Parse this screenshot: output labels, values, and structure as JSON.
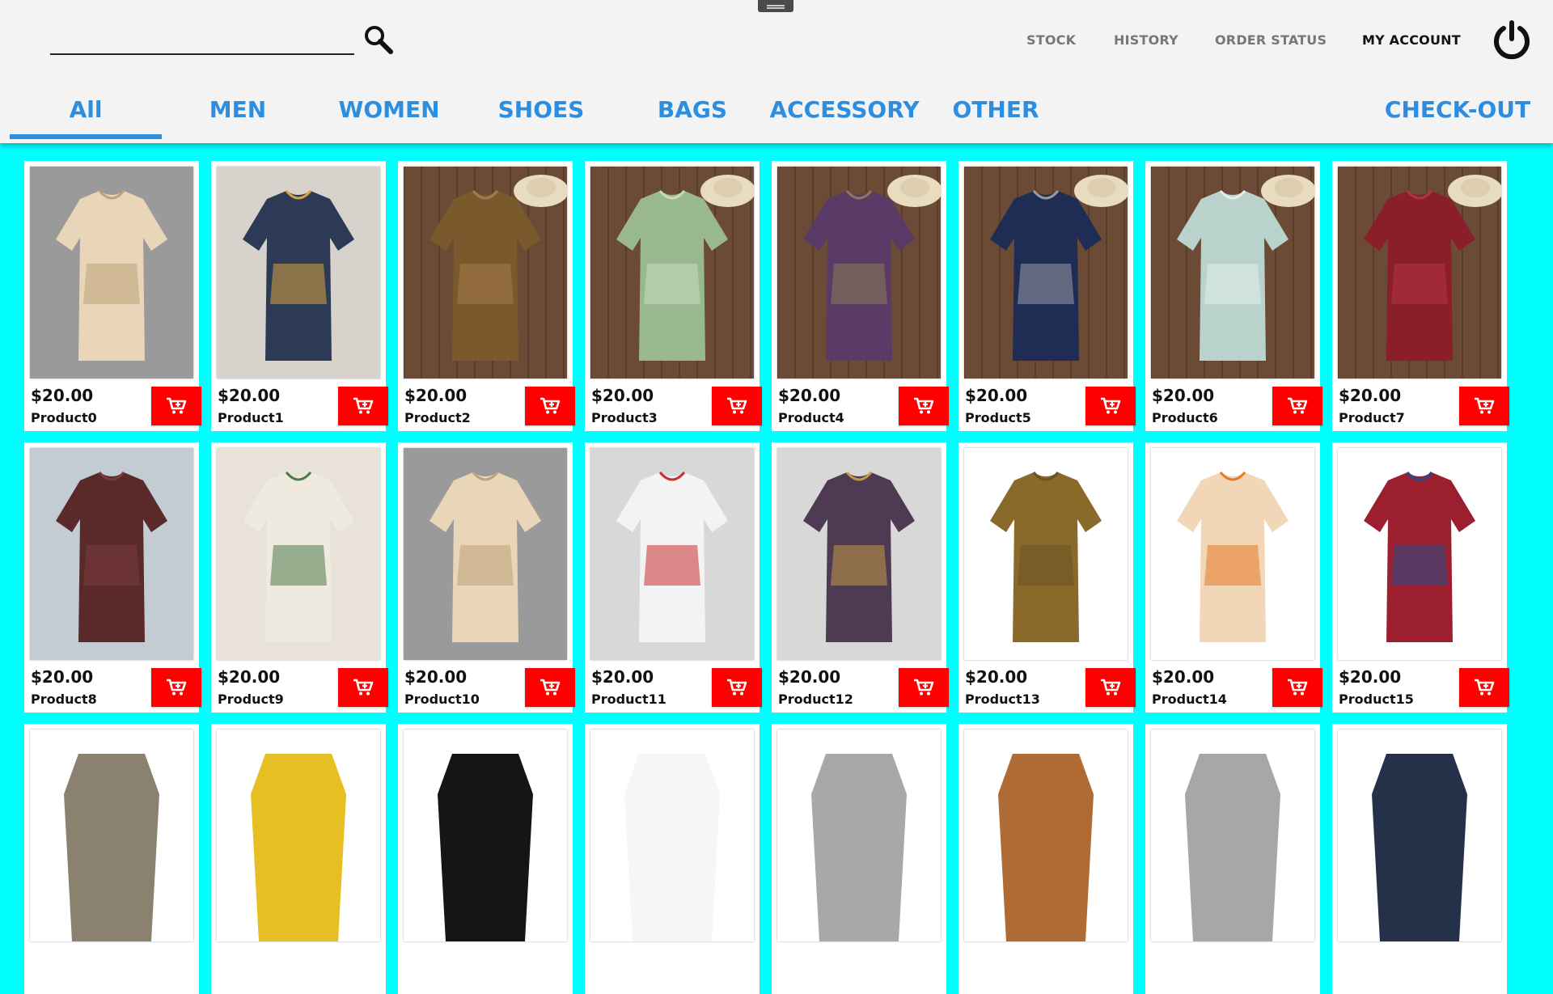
{
  "search": {
    "placeholder": ""
  },
  "topnav": {
    "stock": "STOCK",
    "history": "HISTORY",
    "order_status": "ORDER STATUS",
    "my_account": "MY ACCOUNT"
  },
  "categories": [
    "All",
    "MEN",
    "WOMEN",
    "SHOES",
    "BAGS",
    "ACCESSORY",
    "OTHER"
  ],
  "checkout": "CHECK-OUT",
  "colors": {
    "accent": "#2d8ee0",
    "cart": "#ff0000",
    "background": "#00ffff"
  },
  "products": [
    {
      "name": "Product0",
      "price": "$20.00"
    },
    {
      "name": "Product1",
      "price": "$20.00"
    },
    {
      "name": "Product2",
      "price": "$20.00"
    },
    {
      "name": "Product3",
      "price": "$20.00"
    },
    {
      "name": "Product4",
      "price": "$20.00"
    },
    {
      "name": "Product5",
      "price": "$20.00"
    },
    {
      "name": "Product6",
      "price": "$20.00"
    },
    {
      "name": "Product7",
      "price": "$20.00"
    },
    {
      "name": "Product8",
      "price": "$20.00"
    },
    {
      "name": "Product9",
      "price": "$20.00"
    },
    {
      "name": "Product10",
      "price": "$20.00"
    },
    {
      "name": "Product11",
      "price": "$20.00"
    },
    {
      "name": "Product12",
      "price": "$20.00"
    },
    {
      "name": "Product13",
      "price": "$20.00"
    },
    {
      "name": "Product14",
      "price": "$20.00"
    },
    {
      "name": "Product15",
      "price": "$20.00"
    }
  ]
}
